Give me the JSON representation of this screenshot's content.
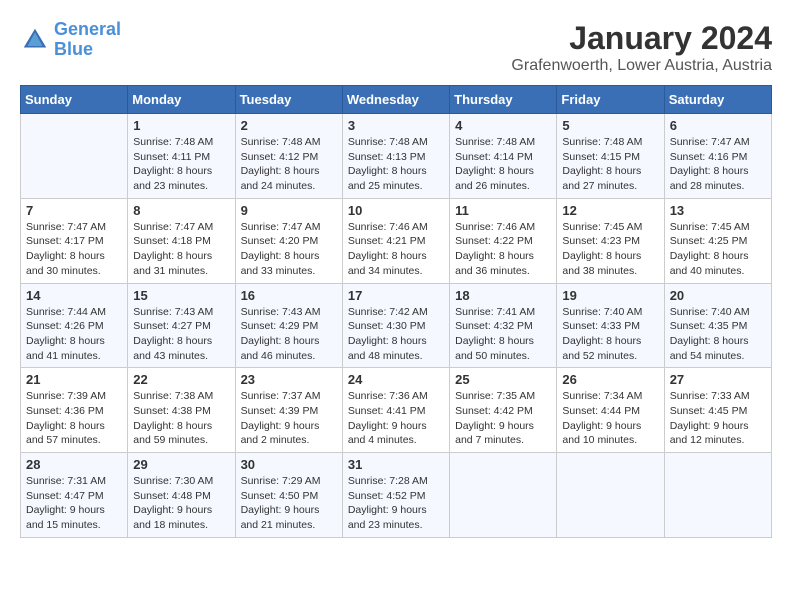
{
  "logo": {
    "line1": "General",
    "line2": "Blue"
  },
  "title": "January 2024",
  "subtitle": "Grafenwoerth, Lower Austria, Austria",
  "days_of_week": [
    "Sunday",
    "Monday",
    "Tuesday",
    "Wednesday",
    "Thursday",
    "Friday",
    "Saturday"
  ],
  "weeks": [
    [
      {
        "num": "",
        "data": ""
      },
      {
        "num": "1",
        "data": "Sunrise: 7:48 AM\nSunset: 4:11 PM\nDaylight: 8 hours\nand 23 minutes."
      },
      {
        "num": "2",
        "data": "Sunrise: 7:48 AM\nSunset: 4:12 PM\nDaylight: 8 hours\nand 24 minutes."
      },
      {
        "num": "3",
        "data": "Sunrise: 7:48 AM\nSunset: 4:13 PM\nDaylight: 8 hours\nand 25 minutes."
      },
      {
        "num": "4",
        "data": "Sunrise: 7:48 AM\nSunset: 4:14 PM\nDaylight: 8 hours\nand 26 minutes."
      },
      {
        "num": "5",
        "data": "Sunrise: 7:48 AM\nSunset: 4:15 PM\nDaylight: 8 hours\nand 27 minutes."
      },
      {
        "num": "6",
        "data": "Sunrise: 7:47 AM\nSunset: 4:16 PM\nDaylight: 8 hours\nand 28 minutes."
      }
    ],
    [
      {
        "num": "7",
        "data": "Sunrise: 7:47 AM\nSunset: 4:17 PM\nDaylight: 8 hours\nand 30 minutes."
      },
      {
        "num": "8",
        "data": "Sunrise: 7:47 AM\nSunset: 4:18 PM\nDaylight: 8 hours\nand 31 minutes."
      },
      {
        "num": "9",
        "data": "Sunrise: 7:47 AM\nSunset: 4:20 PM\nDaylight: 8 hours\nand 33 minutes."
      },
      {
        "num": "10",
        "data": "Sunrise: 7:46 AM\nSunset: 4:21 PM\nDaylight: 8 hours\nand 34 minutes."
      },
      {
        "num": "11",
        "data": "Sunrise: 7:46 AM\nSunset: 4:22 PM\nDaylight: 8 hours\nand 36 minutes."
      },
      {
        "num": "12",
        "data": "Sunrise: 7:45 AM\nSunset: 4:23 PM\nDaylight: 8 hours\nand 38 minutes."
      },
      {
        "num": "13",
        "data": "Sunrise: 7:45 AM\nSunset: 4:25 PM\nDaylight: 8 hours\nand 40 minutes."
      }
    ],
    [
      {
        "num": "14",
        "data": "Sunrise: 7:44 AM\nSunset: 4:26 PM\nDaylight: 8 hours\nand 41 minutes."
      },
      {
        "num": "15",
        "data": "Sunrise: 7:43 AM\nSunset: 4:27 PM\nDaylight: 8 hours\nand 43 minutes."
      },
      {
        "num": "16",
        "data": "Sunrise: 7:43 AM\nSunset: 4:29 PM\nDaylight: 8 hours\nand 46 minutes."
      },
      {
        "num": "17",
        "data": "Sunrise: 7:42 AM\nSunset: 4:30 PM\nDaylight: 8 hours\nand 48 minutes."
      },
      {
        "num": "18",
        "data": "Sunrise: 7:41 AM\nSunset: 4:32 PM\nDaylight: 8 hours\nand 50 minutes."
      },
      {
        "num": "19",
        "data": "Sunrise: 7:40 AM\nSunset: 4:33 PM\nDaylight: 8 hours\nand 52 minutes."
      },
      {
        "num": "20",
        "data": "Sunrise: 7:40 AM\nSunset: 4:35 PM\nDaylight: 8 hours\nand 54 minutes."
      }
    ],
    [
      {
        "num": "21",
        "data": "Sunrise: 7:39 AM\nSunset: 4:36 PM\nDaylight: 8 hours\nand 57 minutes."
      },
      {
        "num": "22",
        "data": "Sunrise: 7:38 AM\nSunset: 4:38 PM\nDaylight: 8 hours\nand 59 minutes."
      },
      {
        "num": "23",
        "data": "Sunrise: 7:37 AM\nSunset: 4:39 PM\nDaylight: 9 hours\nand 2 minutes."
      },
      {
        "num": "24",
        "data": "Sunrise: 7:36 AM\nSunset: 4:41 PM\nDaylight: 9 hours\nand 4 minutes."
      },
      {
        "num": "25",
        "data": "Sunrise: 7:35 AM\nSunset: 4:42 PM\nDaylight: 9 hours\nand 7 minutes."
      },
      {
        "num": "26",
        "data": "Sunrise: 7:34 AM\nSunset: 4:44 PM\nDaylight: 9 hours\nand 10 minutes."
      },
      {
        "num": "27",
        "data": "Sunrise: 7:33 AM\nSunset: 4:45 PM\nDaylight: 9 hours\nand 12 minutes."
      }
    ],
    [
      {
        "num": "28",
        "data": "Sunrise: 7:31 AM\nSunset: 4:47 PM\nDaylight: 9 hours\nand 15 minutes."
      },
      {
        "num": "29",
        "data": "Sunrise: 7:30 AM\nSunset: 4:48 PM\nDaylight: 9 hours\nand 18 minutes."
      },
      {
        "num": "30",
        "data": "Sunrise: 7:29 AM\nSunset: 4:50 PM\nDaylight: 9 hours\nand 21 minutes."
      },
      {
        "num": "31",
        "data": "Sunrise: 7:28 AM\nSunset: 4:52 PM\nDaylight: 9 hours\nand 23 minutes."
      },
      {
        "num": "",
        "data": ""
      },
      {
        "num": "",
        "data": ""
      },
      {
        "num": "",
        "data": ""
      }
    ]
  ]
}
